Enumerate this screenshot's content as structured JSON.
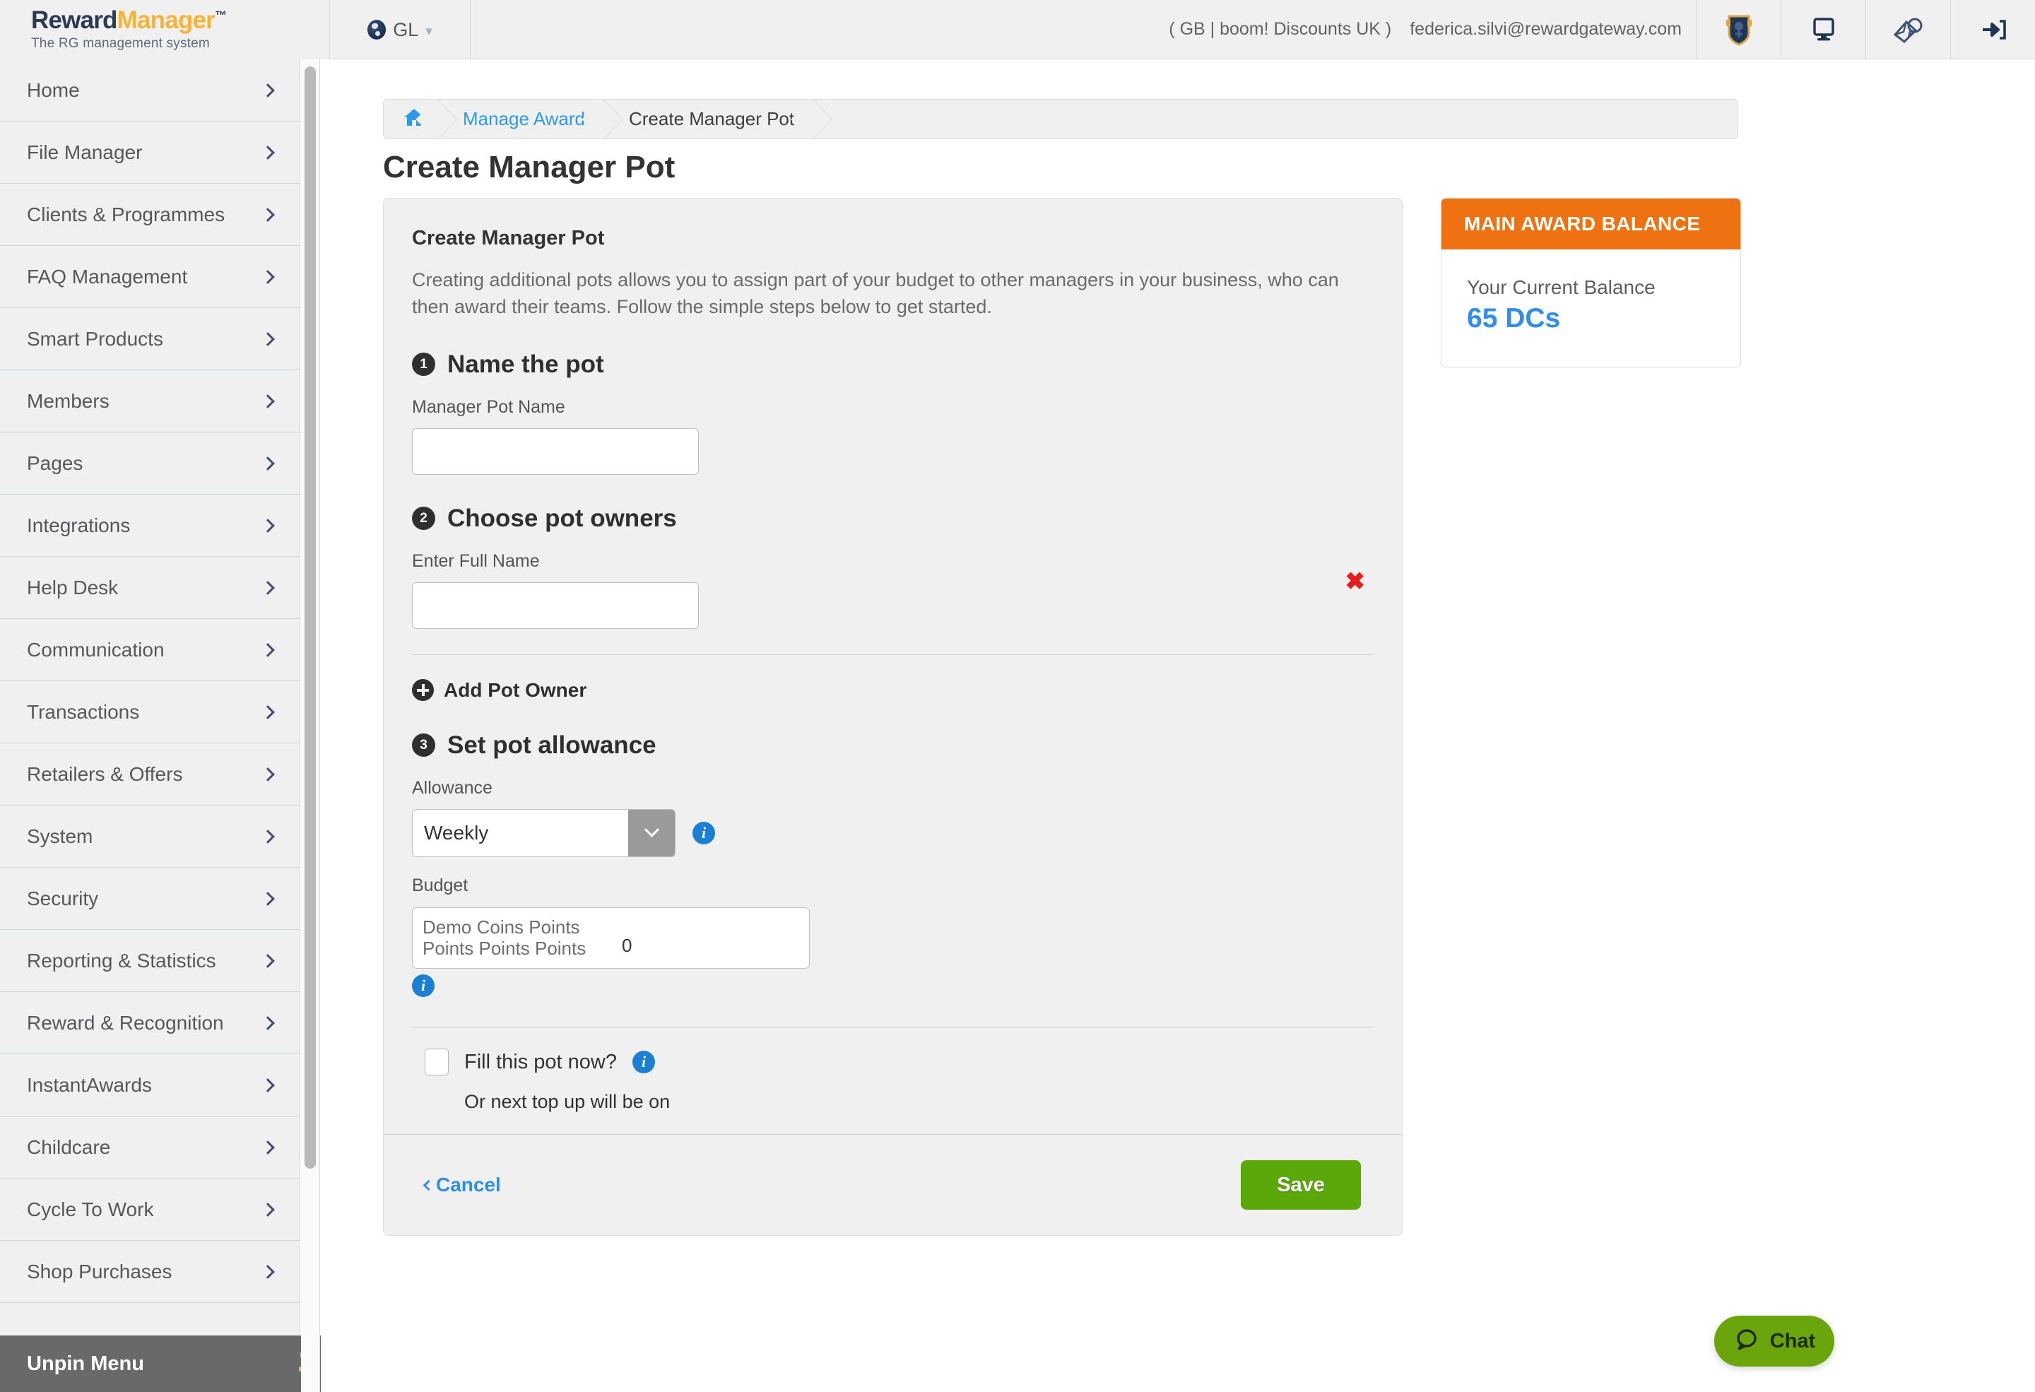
{
  "brand": {
    "name_part1": "Reward",
    "name_part2": "Manager",
    "trademark": "™",
    "tagline": "The RG management system"
  },
  "header": {
    "locale_label": "GL",
    "locale_caret": "⌄",
    "context": "( GB | boom! Discounts UK )",
    "user_email": "federica.silvi@rewardgateway.com",
    "icons": [
      "shield-badge-icon",
      "monitor-icon",
      "mail-chat-icon",
      "logout-icon"
    ]
  },
  "sidebar": {
    "items": [
      {
        "label": "Home"
      },
      {
        "label": "File Manager"
      },
      {
        "label": "Clients & Programmes"
      },
      {
        "label": "FAQ Management"
      },
      {
        "label": "Smart Products"
      },
      {
        "label": "Members"
      },
      {
        "label": "Pages"
      },
      {
        "label": "Integrations"
      },
      {
        "label": "Help Desk"
      },
      {
        "label": "Communication"
      },
      {
        "label": "Transactions"
      },
      {
        "label": "Retailers & Offers"
      },
      {
        "label": "System"
      },
      {
        "label": "Security"
      },
      {
        "label": "Reporting & Statistics"
      },
      {
        "label": "Reward & Recognition"
      },
      {
        "label": "InstantAwards"
      },
      {
        "label": "Childcare"
      },
      {
        "label": "Cycle To Work"
      },
      {
        "label": "Shop Purchases"
      }
    ],
    "footer_label": "Unpin Menu"
  },
  "breadcrumb": {
    "home_icon": "🏠",
    "items": [
      {
        "label": "Manage Award",
        "is_link": true
      },
      {
        "label": "Create Manager Pot",
        "is_link": false
      }
    ]
  },
  "page": {
    "title": "Create Manager Pot"
  },
  "form": {
    "heading": "Create Manager Pot",
    "description": "Creating additional pots allows you to assign part of your budget to other managers in your business, who can then award their teams. Follow the simple steps below to get started.",
    "step1": {
      "number": "1",
      "title": "Name the pot",
      "field_label": "Manager Pot Name",
      "value": "",
      "placeholder": ""
    },
    "step2": {
      "number": "2",
      "title": "Choose pot owners",
      "field_label": "Enter Full Name",
      "value": "",
      "placeholder": "",
      "remove_icon": "✖",
      "add_owner_label": "Add Pot Owner"
    },
    "step3": {
      "number": "3",
      "title": "Set pot allowance",
      "allowance_label": "Allowance",
      "allowance_value": "Weekly",
      "allowance_options": [
        "Weekly"
      ],
      "budget_label": "Budget",
      "budget_prefix": "Demo Coins Points Points Points Points",
      "budget_value": "0"
    },
    "fill": {
      "checkbox_label": "Fill this pot now?",
      "checked": false,
      "topup_note": "Or next top up will be on"
    },
    "cancel_label": "Cancel",
    "save_label": "Save"
  },
  "balance": {
    "header": "MAIN AWARD BALANCE",
    "label": "Your Current Balance",
    "value": "65 DCs",
    "accent_color": "#ee7211",
    "value_color": "#2f8fe8"
  },
  "chat": {
    "label": "Chat",
    "color": "#6aa60b"
  }
}
